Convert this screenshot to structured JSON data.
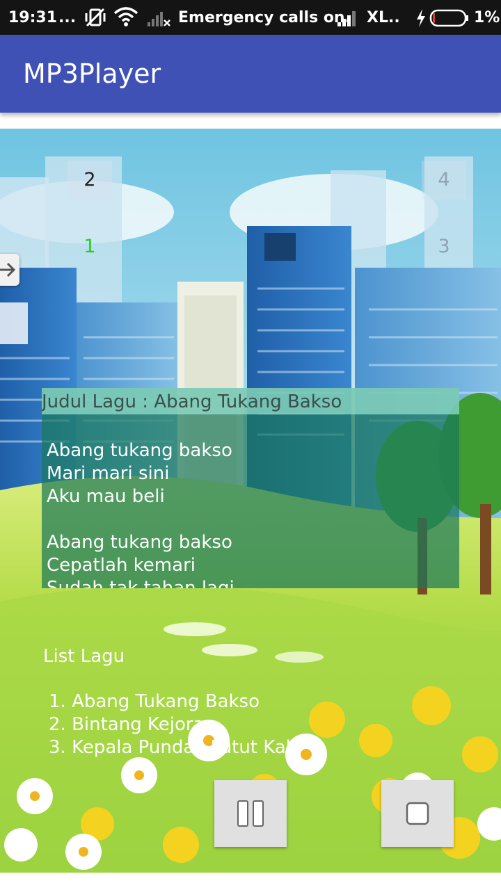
{
  "status_bar": {
    "time": "19:31",
    "dots": "...",
    "carrier_text": "Emergency calls on..",
    "network": "XL..",
    "battery_percent": "1%"
  },
  "app_bar": {
    "title": "MP3Player"
  },
  "number_buttons": {
    "b1": "1",
    "b2": "2",
    "b3": "3",
    "b4": "4"
  },
  "lyrics": {
    "header": "Judul Lagu : Abang Tukang Bakso",
    "lines": [
      "Abang tukang bakso",
      "Mari mari sini",
      "Aku mau beli",
      "",
      "Abang tukang bakso",
      "Cepatlah kemari",
      "Sudah tak tahan lagi"
    ]
  },
  "song_list": {
    "title": "List Lagu",
    "items": [
      "1. Abang Tukang Bakso",
      "2. Bintang Kejora",
      "3. Kepala Pundak Lutut Kaki"
    ]
  },
  "controls": {
    "pause_icon": "pause-icon",
    "stop_icon": "stop-icon"
  },
  "icons": {
    "side": "arrow-right-icon"
  }
}
